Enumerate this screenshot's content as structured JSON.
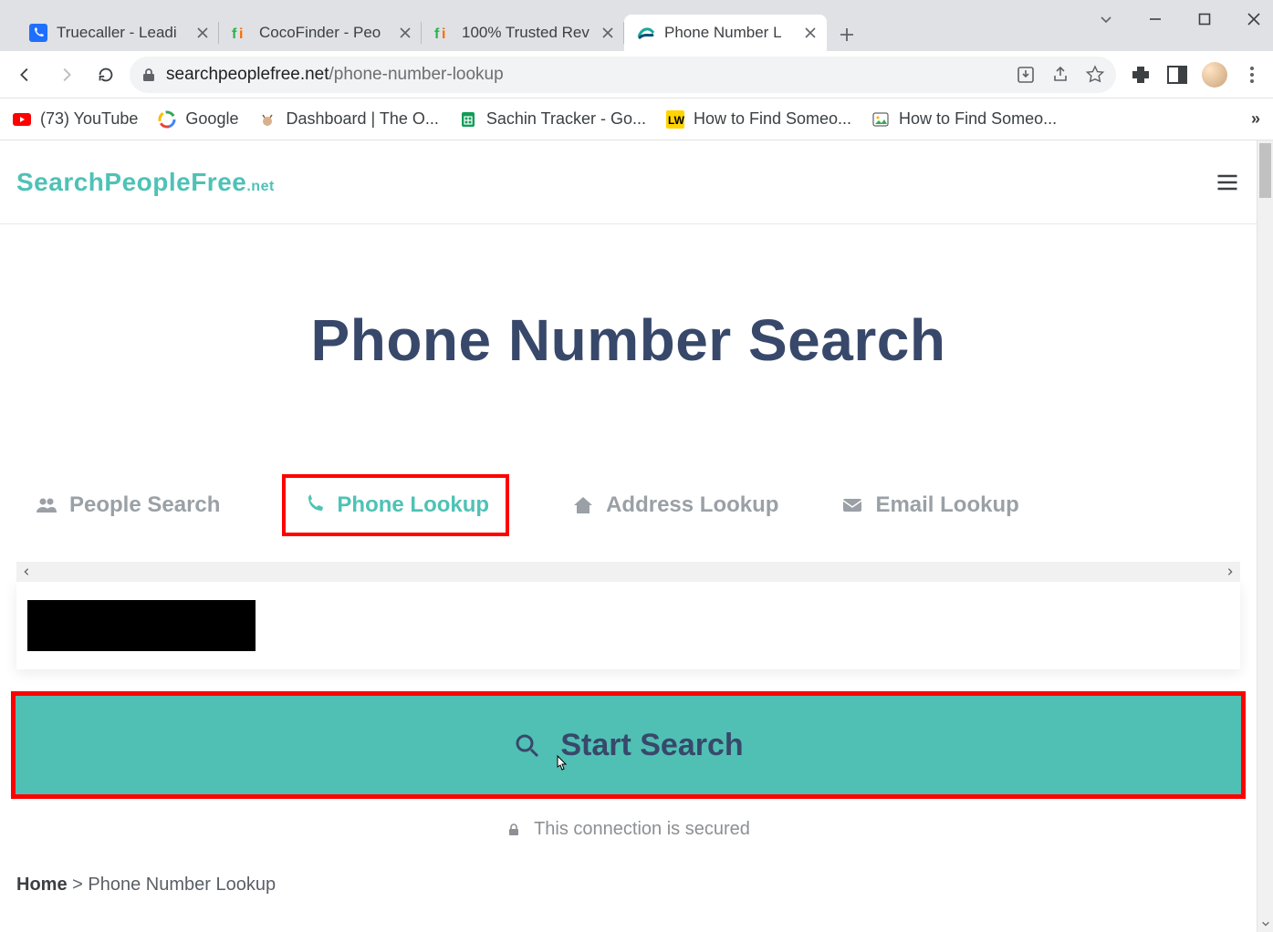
{
  "window": {
    "tabs": [
      {
        "title": "Truecaller - Leadi",
        "favicon": "phone-blue",
        "active": false
      },
      {
        "title": "CocoFinder - Peo",
        "favicon": "fi-green",
        "active": false
      },
      {
        "title": "100% Trusted Rev",
        "favicon": "fi-green",
        "active": false
      },
      {
        "title": "Phone Number L",
        "favicon": "swoosh-teal",
        "active": true
      }
    ]
  },
  "address_bar": {
    "host": "searchpeoplefree.net",
    "path": "/phone-number-lookup"
  },
  "bookmarks": [
    {
      "label": "(73) YouTube",
      "icon": "youtube"
    },
    {
      "label": "Google",
      "icon": "google-g"
    },
    {
      "label": "Dashboard | The O...",
      "icon": "deer"
    },
    {
      "label": "Sachin Tracker - Go...",
      "icon": "sheets"
    },
    {
      "label": "How to Find Someo...",
      "icon": "lw"
    },
    {
      "label": "How to Find Someo...",
      "icon": "pic"
    }
  ],
  "site": {
    "logo_main": "SearchPeopleFree",
    "logo_suffix": ".net"
  },
  "hero": {
    "title": "Phone Number Search"
  },
  "search_tabs": [
    {
      "label": "People Search",
      "icon": "people",
      "active": false
    },
    {
      "label": "Phone Lookup",
      "icon": "phone",
      "active": true,
      "highlighted": true
    },
    {
      "label": "Address Lookup",
      "icon": "home",
      "active": false
    },
    {
      "label": "Email Lookup",
      "icon": "mail",
      "active": false
    }
  ],
  "start_button": {
    "label": "Start Search"
  },
  "secure_text": "This connection is secured",
  "breadcrumb": {
    "home": "Home",
    "sep": ">",
    "current": "Phone Number Lookup"
  }
}
